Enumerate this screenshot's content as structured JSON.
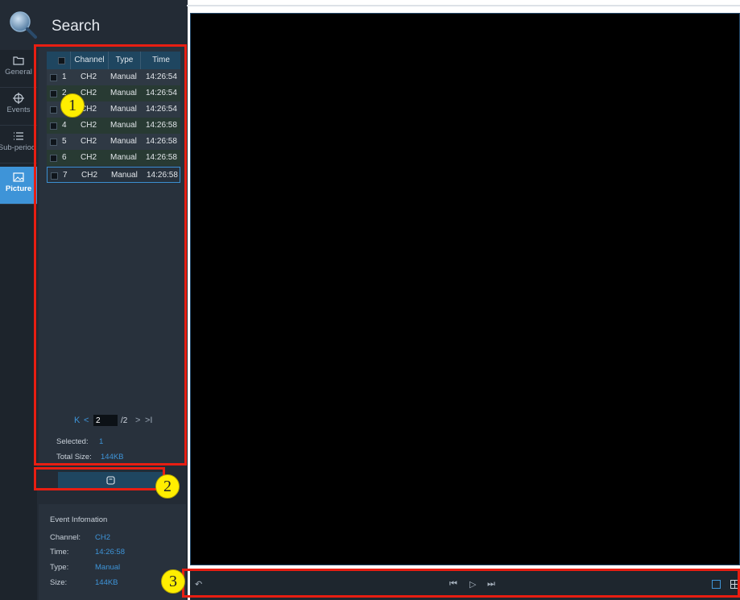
{
  "header": {
    "title": "Search",
    "logo_icon": "magnifier-icon"
  },
  "sidebar": {
    "items": [
      {
        "label": "General",
        "icon": "folder-icon",
        "active": false
      },
      {
        "label": "Events",
        "icon": "target-icon",
        "active": false
      },
      {
        "label": "Sub-period",
        "icon": "list-icon",
        "active": false
      },
      {
        "label": "Picture",
        "icon": "image-icon",
        "active": true
      }
    ]
  },
  "table": {
    "columns": [
      "Channel",
      "Type",
      "Time"
    ],
    "rows": [
      {
        "no": "1",
        "channel": "CH2",
        "type": "Manual",
        "time": "14:26:54"
      },
      {
        "no": "2",
        "channel": "CH2",
        "type": "Manual",
        "time": "14:26:54"
      },
      {
        "no": "3",
        "channel": "CH2",
        "type": "Manual",
        "time": "14:26:54"
      },
      {
        "no": "4",
        "channel": "CH2",
        "type": "Manual",
        "time": "14:26:58"
      },
      {
        "no": "5",
        "channel": "CH2",
        "type": "Manual",
        "time": "14:26:58"
      },
      {
        "no": "6",
        "channel": "CH2",
        "type": "Manual",
        "time": "14:26:58"
      },
      {
        "no": "7",
        "channel": "CH2",
        "type": "Manual",
        "time": "14:26:58"
      }
    ],
    "selected_row": 7
  },
  "pager": {
    "first": "K",
    "prev": "<",
    "current": "2",
    "total": "/2",
    "next": ">",
    "last": ">I"
  },
  "summary": {
    "selected_label": "Selected:",
    "selected_value": "1",
    "size_label": "Total Size:",
    "size_value": "144KB"
  },
  "save_button": {
    "icon": "save-icon"
  },
  "event_info": {
    "title": "Event Infomation",
    "channel_label": "Channel:",
    "channel_value": "CH2",
    "time_label": "Time:",
    "time_value": "14:26:58",
    "type_label": "Type:",
    "type_value": "Manual",
    "size_label": "Size:",
    "size_value": "144KB"
  },
  "markers": [
    "1",
    "2",
    "3"
  ],
  "playback": {
    "icons": [
      "back-icon",
      "previous-icon",
      "play-icon",
      "next-icon",
      "single-view-icon",
      "quad-view-icon"
    ]
  },
  "colors": {
    "accent": "#3e94d8",
    "annotation_red": "#e81e12",
    "marker_yellow": "#ffee00"
  }
}
